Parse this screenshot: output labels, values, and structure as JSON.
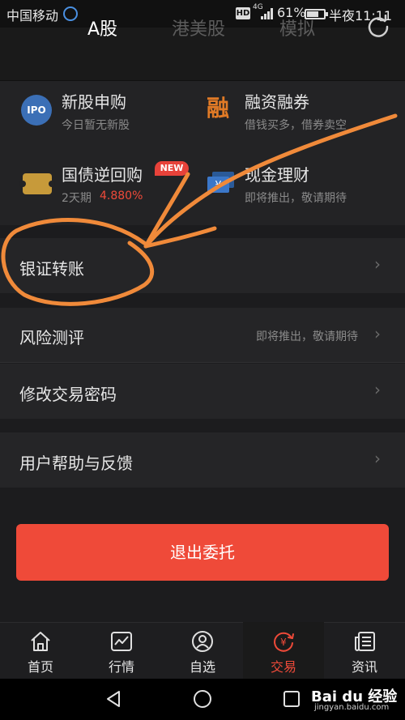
{
  "status_bar": {
    "carrier": "中国移动",
    "hd": "HD",
    "network": "4G",
    "battery": "61%",
    "time": "半夜11:11"
  },
  "header": {
    "tabs": [
      {
        "label": "A股",
        "active": true
      },
      {
        "label": "港美股",
        "active": false
      },
      {
        "label": "模拟",
        "active": false
      }
    ],
    "refresh_icon": "refresh-icon"
  },
  "quick_actions": [
    {
      "icon": "ipo-icon",
      "icon_text": "IPO",
      "title": "新股申购",
      "subtitle": "今日暂无新股"
    },
    {
      "icon": "margin-trading-icon",
      "icon_text": "融",
      "title": "融资融券",
      "subtitle": "借钱买多，借券卖空"
    },
    {
      "icon": "ticket-icon",
      "title": "国债逆回购",
      "subtitle": "2天期",
      "rate": "4.880%",
      "badge": "NEW"
    },
    {
      "icon": "cash-management-icon",
      "title": "现金理财",
      "subtitle": "即将推出，敬请期待"
    }
  ],
  "list": {
    "bank_transfer": "银证转账",
    "risk_assessment": "风险测评",
    "risk_hint": "即将推出，敬请期待",
    "change_password": "修改交易密码",
    "help_feedback": "用户帮助与反馈",
    "chevron": "›"
  },
  "logout_label": "退出委托",
  "bottom_nav": [
    {
      "label": "首页",
      "icon": "home-icon",
      "active": false
    },
    {
      "label": "行情",
      "icon": "market-chart-icon",
      "active": false
    },
    {
      "label": "自选",
      "icon": "watchlist-user-icon",
      "active": false
    },
    {
      "label": "交易",
      "icon": "trade-yuan-icon",
      "active": true
    },
    {
      "label": "资讯",
      "icon": "news-icon",
      "active": false
    }
  ],
  "watermark": {
    "brand": "Bai du 经验",
    "url": "jingyan.baidu.com"
  },
  "colors": {
    "accent": "#ef4a39",
    "annotation": "#f08a3a",
    "ipo_blue": "#3b6fb6",
    "margin_orange": "#e07a26"
  }
}
